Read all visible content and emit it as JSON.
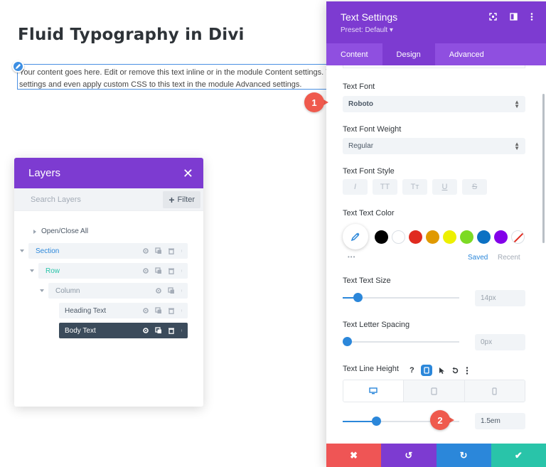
{
  "page": {
    "title": "Fluid Typography in Divi",
    "body_text_line1": "Your content goes here. Edit or remove this text inline or in the module Content settings. Y",
    "body_text_line2": "settings and even apply custom CSS to this text in the module Advanced settings."
  },
  "layers": {
    "title": "Layers",
    "close_glyph": "✕",
    "search_placeholder": "Search Layers",
    "filter_label": "Filter",
    "open_close_label": "Open/Close All",
    "items": [
      {
        "label": "Section",
        "color": "#2b87da"
      },
      {
        "label": "Row",
        "color": "#29c4a9"
      },
      {
        "label": "Column",
        "color": "#8a96a3"
      },
      {
        "label": "Heading Text",
        "color": "#4c5866"
      },
      {
        "label": "Body Text",
        "color": "#ffffff",
        "active": true
      }
    ]
  },
  "settings": {
    "title": "Text Settings",
    "preset": "Preset: Default ▾",
    "tabs": [
      {
        "label": "Content",
        "active": false
      },
      {
        "label": "Design",
        "active": true
      },
      {
        "label": "Advanced",
        "active": false
      }
    ],
    "text_font_label": "Text Font",
    "text_font_value": "Roboto",
    "font_weight_label": "Text Font Weight",
    "font_weight_value": "Regular",
    "font_style_label": "Text Font Style",
    "font_style_buttons": [
      "I",
      "TT",
      "Tт",
      "U",
      "S"
    ],
    "text_color_label": "Text Text Color",
    "swatches": [
      "#000000",
      "#ffffff",
      "#e02b20",
      "#e09900",
      "#edf000",
      "#7cda24",
      "#0c71c3",
      "#8300e9"
    ],
    "saved_label": "Saved",
    "recent_label": "Recent",
    "more_glyph": "•••",
    "text_size_label": "Text Text Size",
    "text_size_value": "14px",
    "text_size_level": 0.1,
    "letter_spacing_label": "Text Letter Spacing",
    "letter_spacing_value": "0px",
    "letter_spacing_level": 0.0,
    "line_height_label": "Text Line Height",
    "line_height_value": "1.5em",
    "line_height_level": 0.27,
    "footer": {
      "cancel_glyph": "✖",
      "undo_glyph": "↺",
      "redo_glyph": "↻",
      "save_glyph": "✔",
      "colors": [
        "#ef5555",
        "#7d3bd1",
        "#2b87da",
        "#29c4a9"
      ]
    }
  },
  "callouts": [
    {
      "number": "1"
    },
    {
      "number": "2"
    }
  ],
  "colors": {
    "purple": "#7d3bd1",
    "purple_light": "#8f4fe0",
    "blue": "#2b87da",
    "callout_red": "#ef5a4d"
  }
}
